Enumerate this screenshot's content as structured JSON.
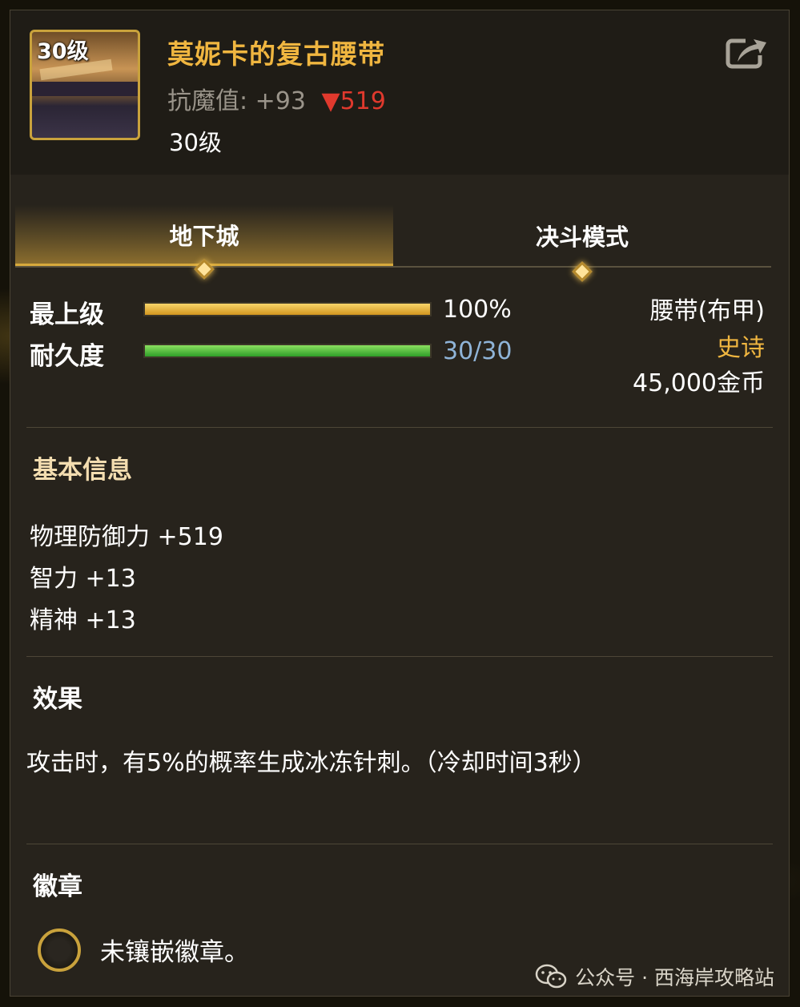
{
  "item": {
    "icon_level": "30级",
    "name": "莫妮卡的复古腰带",
    "magic_resist_label": "抗魔值:",
    "magic_resist_value": "+93",
    "magic_resist_diff": "▼519",
    "level": "30级"
  },
  "tabs": [
    {
      "label": "地下城",
      "active": true
    },
    {
      "label": "决斗模式",
      "active": false
    }
  ],
  "stats": {
    "grade_label": "最上级",
    "grade_value": "100%",
    "grade_fraction": 1.0,
    "durability_label": "耐久度",
    "durability_value": "30/30",
    "durability_fraction": 1.0
  },
  "meta": {
    "type": "腰带(布甲)",
    "rarity": "史诗",
    "price": "45,000金币"
  },
  "basic_info": {
    "title": "基本信息",
    "attributes": [
      "物理防御力 +519",
      "智力 +13",
      "精神 +13"
    ]
  },
  "effect": {
    "title": "效果",
    "text": "攻击时，有5%的概率生成冰冻针刺。（冷却时间3秒）"
  },
  "emblem": {
    "title": "徽章",
    "text": "未镶嵌徽章。"
  },
  "watermark": {
    "text": "公众号 · 西海岸攻略站"
  },
  "colors": {
    "item_name": "#f0b640",
    "rarity": "#f0b640",
    "down_arrow": "#e0392d",
    "durability_text": "#8fb4d8"
  }
}
